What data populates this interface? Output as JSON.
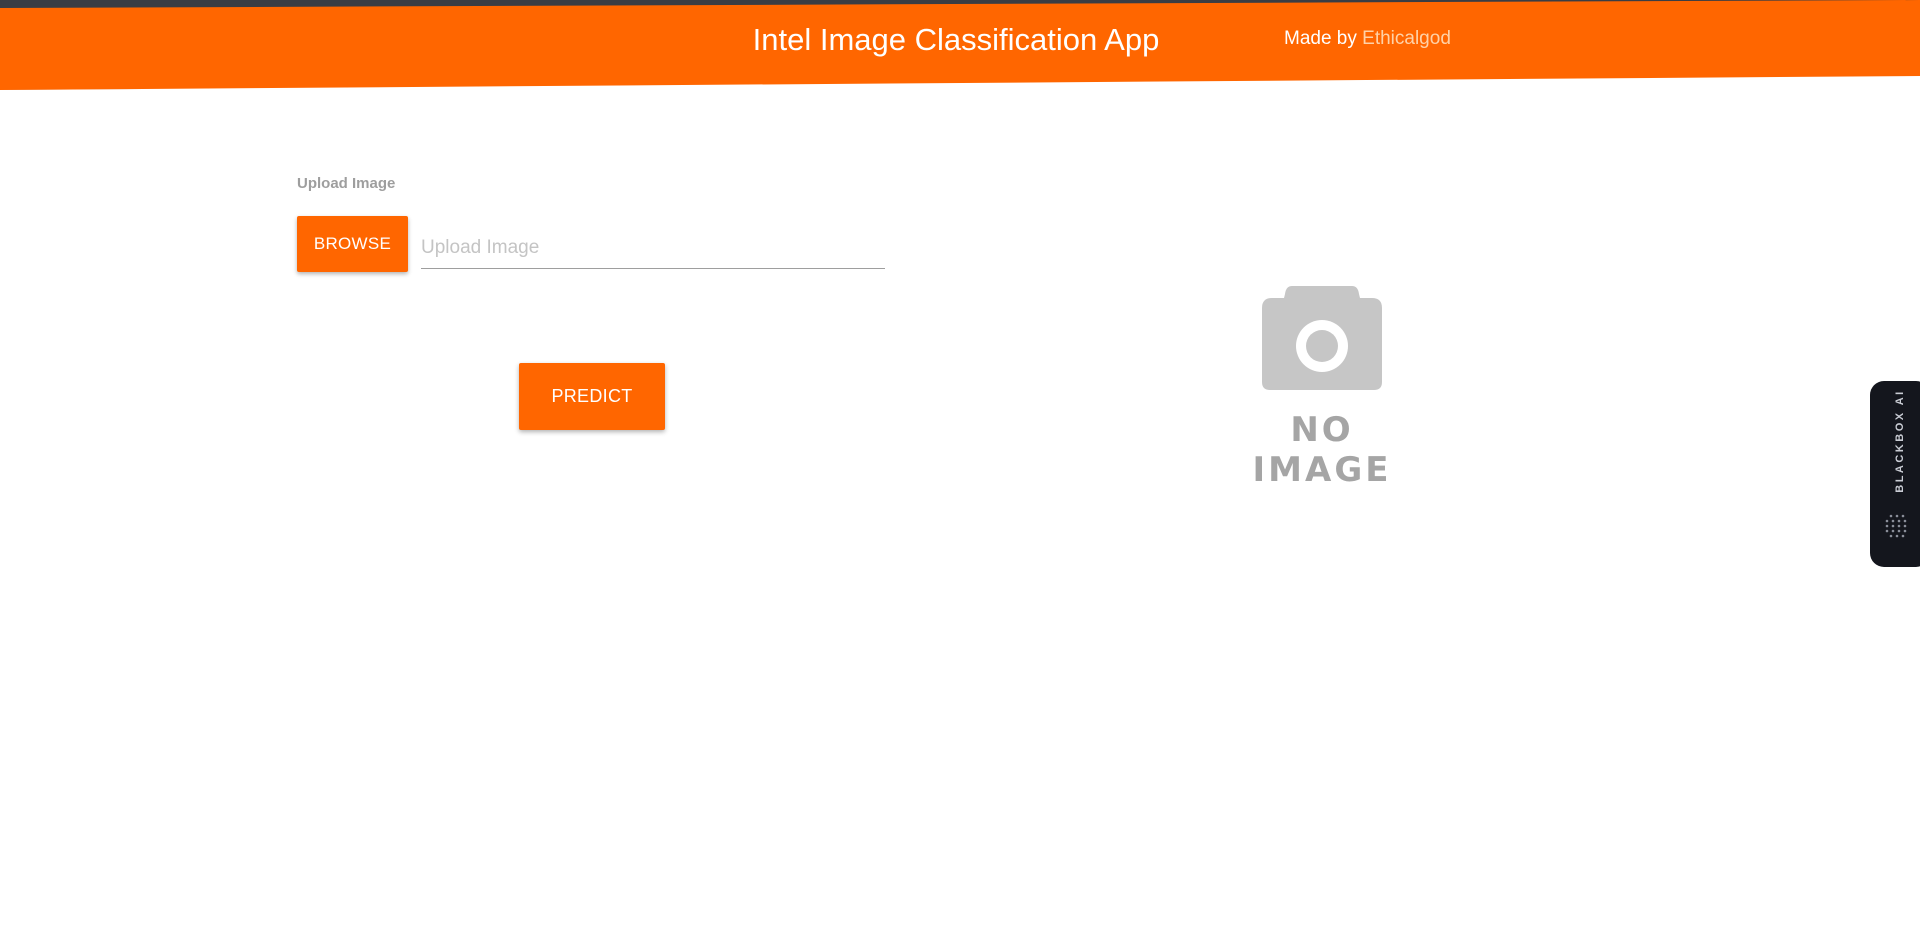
{
  "header": {
    "title": "Intel Image Classification App",
    "made_by_prefix": "Made by ",
    "made_by_author": "Ethicalgod"
  },
  "upload": {
    "label": "Upload Image",
    "browse_label": "BROWSE",
    "placeholder": "Upload Image"
  },
  "predict_label": "PREDICT",
  "preview": {
    "icon": "camera-icon",
    "text": "NO IMAGE"
  },
  "side_tab": {
    "label": "BLACKBOX AI",
    "icon": "blackbox-logo-icon"
  },
  "colors": {
    "accent": "#ff6600",
    "author_link": "#ffd2a8",
    "placeholder_gray": "#c4c4c4",
    "side_tab_bg": "#14161d"
  }
}
